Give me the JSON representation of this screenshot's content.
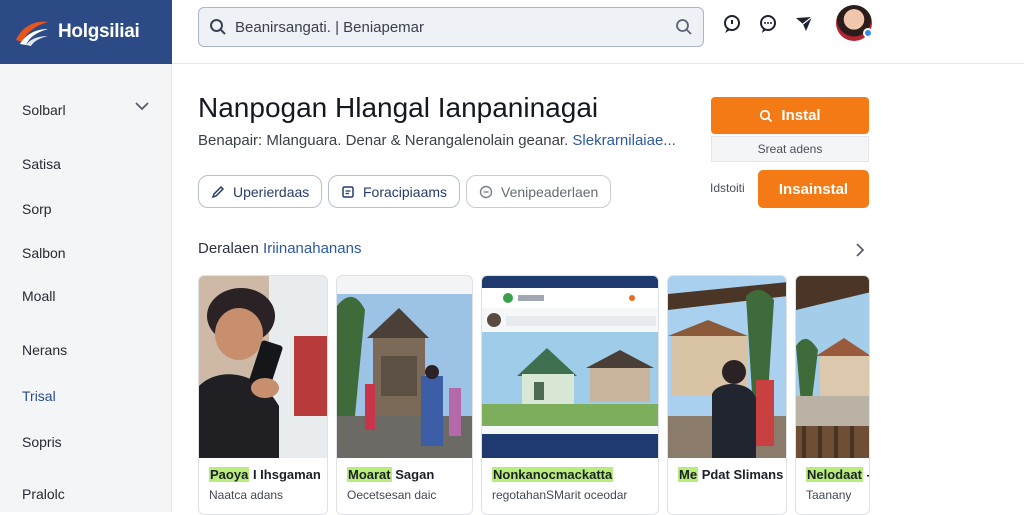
{
  "brand": {
    "name": "Holgsiliai"
  },
  "search": {
    "value": "Beanirsangati. | Beniapemar"
  },
  "top_icons": [
    "chat-bubble-icon",
    "message-icon",
    "send-flag-icon"
  ],
  "sidebar": {
    "items": [
      {
        "label": "Solbarl",
        "active": false
      },
      {
        "label": "Satisa",
        "active": false
      },
      {
        "label": "Sorp",
        "active": false
      },
      {
        "label": "Salbon",
        "active": false
      },
      {
        "label": "Moall",
        "active": false
      },
      {
        "label": "Nerans",
        "active": false
      },
      {
        "label": "Trisal",
        "active": true
      },
      {
        "label": "Sopris",
        "active": false
      },
      {
        "label": "Pralolc",
        "active": false
      }
    ]
  },
  "app": {
    "title": "Nanpogan Hlangal Ianpaninagai",
    "meta": "Benapair: Mlanguara. Denar & Nerangalenolain geanar.",
    "meta_link": "Slekrarnilaiae..."
  },
  "pills": [
    {
      "label": "Uperierdaas",
      "icon": "pencil-icon"
    },
    {
      "label": "Foracipiaams",
      "icon": "document-icon"
    },
    {
      "label": "Venipeaderlaen",
      "icon": "circle-minus-icon"
    }
  ],
  "install": {
    "primary_label": "Instal",
    "sub_label": "Sreat adens",
    "status": "Idstoiti",
    "secondary_label": "Insainstal"
  },
  "section": {
    "title_a": "Deralaen",
    "title_b": "Iriinanahanans"
  },
  "screenshots": [
    {
      "caption_hl": "Paoya",
      "caption": "I Ihsgaman",
      "sub": "Naatca adans"
    },
    {
      "caption_hl": "Moarat",
      "caption": "Sagan",
      "sub": "Oecetsesan daic"
    },
    {
      "caption_hl": "Nonkanocmackatta",
      "caption": "",
      "sub": "regotahanSMarit oceodar"
    },
    {
      "caption_hl": "Me",
      "caption": "Pdat Slimans",
      "sub": ""
    },
    {
      "caption_hl": "Nelodaat",
      "caption": "-",
      "sub": "Taanany"
    }
  ],
  "colors": {
    "brand_bg": "#2b4a86",
    "accent_orange": "#f47a16",
    "link_blue": "#2c5aa0",
    "highlight_green": "#b8ec7b"
  }
}
